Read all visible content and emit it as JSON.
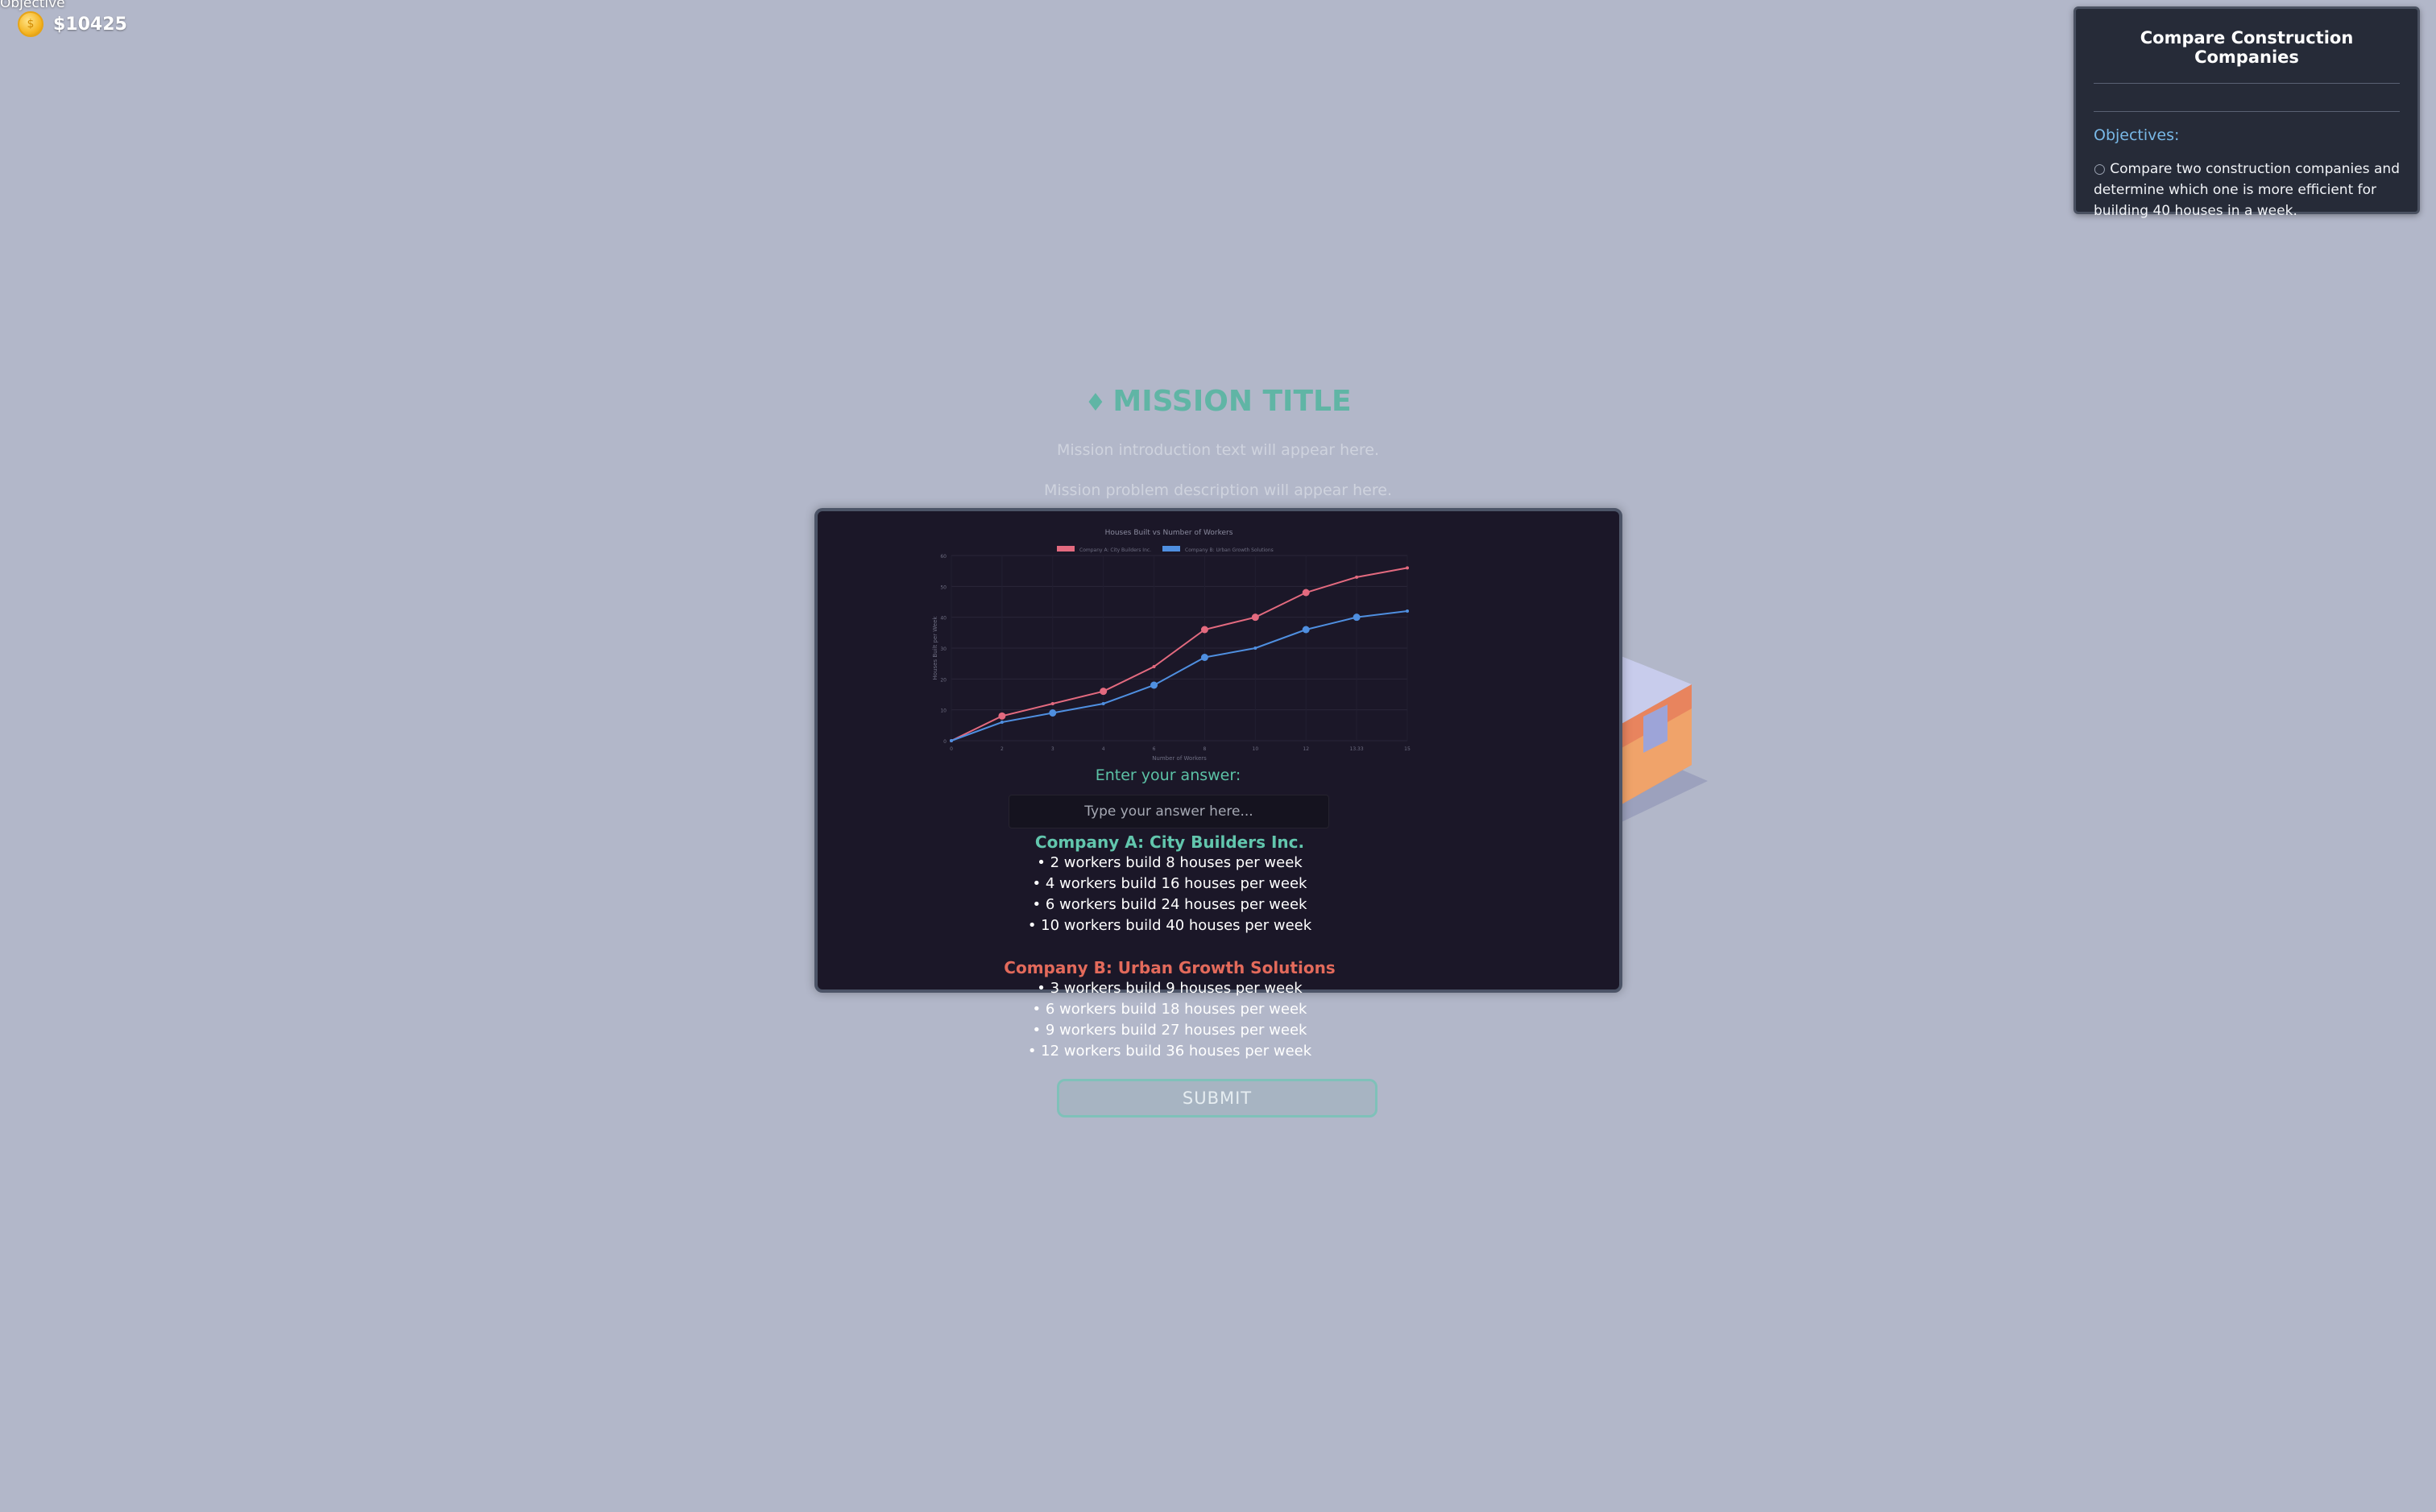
{
  "hud": {
    "label": "Objective",
    "money": "$10425"
  },
  "objectives_panel": {
    "title": "Compare Construction Companies",
    "subtitle": "Objectives:",
    "bullet": "○",
    "text": "Compare two construction companies and determine which one is more efficient for building 40 houses in a week."
  },
  "mission": {
    "title": "MISSION TITLE",
    "intro": "Mission introduction text will appear here.",
    "problem": "Mission problem description will appear here."
  },
  "answer": {
    "label": "Enter your answer:",
    "placeholder": "Type your answer here..."
  },
  "companies": {
    "a": {
      "name": "Company A: City Builders Inc.",
      "lines": [
        "• 2 workers build 8 houses per week",
        "• 4 workers build 16 houses per week",
        "• 6 workers build 24 houses per week",
        "• 10 workers build 40 houses per week"
      ]
    },
    "b": {
      "name": "Company B: Urban Growth Solutions",
      "lines": [
        "• 3 workers build 9 houses per week",
        "• 6 workers build 18 houses per week",
        "• 9 workers build 27 houses per week",
        "• 12 workers build 36 houses per week"
      ]
    }
  },
  "submit_label": "SUBMIT",
  "colors": {
    "company_a": "#e36a7f",
    "company_b": "#4f8fe0",
    "accent": "#52b59f"
  },
  "chart_data": {
    "type": "line",
    "title": "Houses Built vs Number of Workers",
    "xlabel": "Number of Workers",
    "ylabel": "Houses Built per Week",
    "x": [
      "0",
      "2",
      "3",
      "4",
      "6",
      "8",
      "10",
      "12",
      "13.33",
      "15"
    ],
    "ylim": [
      0,
      60
    ],
    "yticks": [
      "0",
      "10",
      "20",
      "30",
      "40",
      "50",
      "60"
    ],
    "series": [
      {
        "name": "Company A: City Builders Inc.",
        "values": [
          0,
          8,
          12,
          16,
          24,
          36,
          40,
          48,
          53,
          56
        ]
      },
      {
        "name": "Company B: Urban Growth Solutions",
        "values": [
          0,
          6,
          9,
          12,
          18,
          27,
          30,
          36,
          40,
          42
        ]
      }
    ],
    "markers": [
      {
        "series": 0,
        "points": [
          1,
          3,
          5,
          6,
          7
        ]
      },
      {
        "series": 1,
        "points": [
          2,
          4,
          5,
          7,
          8
        ]
      }
    ],
    "legend": "top"
  }
}
